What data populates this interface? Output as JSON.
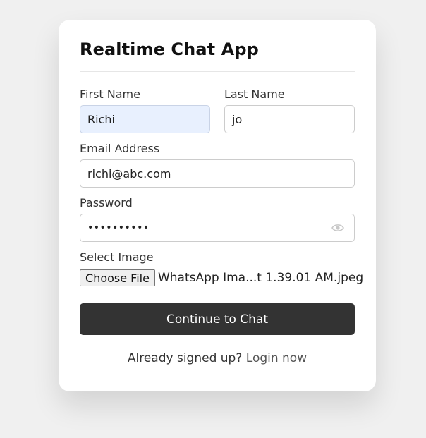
{
  "form": {
    "title": "Realtime Chat App",
    "first_name": {
      "label": "First Name",
      "value": "Richi"
    },
    "last_name": {
      "label": "Last Name",
      "value": "jo"
    },
    "email": {
      "label": "Email Address",
      "value": "richi@abc.com"
    },
    "password": {
      "label": "Password",
      "value": "••••••••••",
      "toggle_icon": "eye-icon"
    },
    "image": {
      "label": "Select Image",
      "button_label": "Choose File",
      "file_name": "WhatsApp Ima...t 1.39.01 AM.jpeg"
    },
    "submit_label": "Continue to Chat",
    "signup_prompt": "Already signed up?",
    "login_link": "Login now"
  },
  "colors": {
    "background": "#f0f0f0",
    "card": "#ffffff",
    "button": "#333333",
    "autofill": "#e8f0fe"
  }
}
